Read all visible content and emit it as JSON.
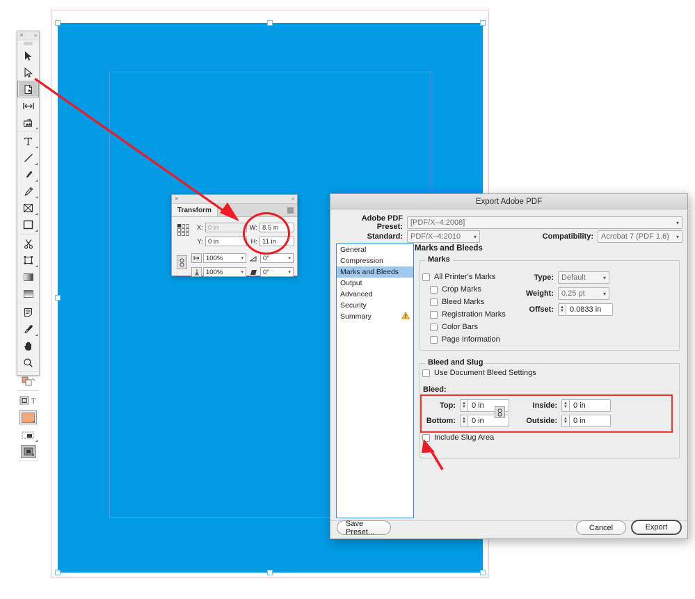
{
  "app": {
    "canvas": {
      "document_fill_color": "#019ae4",
      "page_border_color": "#f6c8cd",
      "margin_guide_color": "#8f7bd6",
      "selection_handle_color": "#6fc5ef"
    }
  },
  "toolbar": {
    "close_glyph": "✕",
    "expand_glyph": "»",
    "tools": [
      {
        "name": "selection-tool",
        "label": "Selection Tool",
        "selected": false,
        "submenu": false
      },
      {
        "name": "direct-selection-tool",
        "label": "Direct Selection Tool",
        "selected": false,
        "submenu": false
      },
      {
        "name": "page-tool",
        "label": "Page Tool",
        "selected": true,
        "submenu": false
      },
      {
        "name": "gap-tool",
        "label": "Gap Tool",
        "selected": false,
        "submenu": false
      },
      {
        "name": "content-collector-tool",
        "label": "Content Collector Tool",
        "selected": false,
        "submenu": true
      },
      {
        "name": "type-tool",
        "label": "Type Tool",
        "selected": false,
        "submenu": true
      },
      {
        "name": "line-tool",
        "label": "Line Tool",
        "selected": false,
        "submenu": true
      },
      {
        "name": "pen-tool",
        "label": "Pen Tool",
        "selected": false,
        "submenu": true
      },
      {
        "name": "pencil-tool",
        "label": "Pencil Tool",
        "selected": false,
        "submenu": true
      },
      {
        "name": "frame-tool",
        "label": "Rectangle Frame Tool",
        "selected": false,
        "submenu": true
      },
      {
        "name": "rectangle-tool",
        "label": "Rectangle Tool",
        "selected": false,
        "submenu": true
      },
      {
        "name": "scissors-tool",
        "label": "Scissors Tool",
        "selected": false,
        "submenu": false
      },
      {
        "name": "free-transform-tool",
        "label": "Free Transform Tool",
        "selected": false,
        "submenu": true
      },
      {
        "name": "gradient-swatch-tool",
        "label": "Gradient Swatch Tool",
        "selected": false,
        "submenu": false
      },
      {
        "name": "gradient-feather-tool",
        "label": "Gradient Feather Tool",
        "selected": false,
        "submenu": false
      },
      {
        "name": "note-tool",
        "label": "Note Tool",
        "selected": false,
        "submenu": false
      },
      {
        "name": "eyedropper-tool",
        "label": "Eyedropper Tool",
        "selected": false,
        "submenu": true
      },
      {
        "name": "hand-tool",
        "label": "Hand Tool",
        "selected": false,
        "submenu": false
      },
      {
        "name": "zoom-tool",
        "label": "Zoom Tool",
        "selected": false,
        "submenu": false
      }
    ],
    "fill_stroke": {
      "fill_color": "#f8a676",
      "label": "Fill and Stroke"
    },
    "formatting_affects": {
      "container_label": "Formatting affects container",
      "text_label": "T"
    },
    "screen_mode": {
      "label": "Screen Mode"
    },
    "apply_mode": {
      "label": "Apply None"
    }
  },
  "transform_panel": {
    "title": "Transform",
    "close_glyph": "✕",
    "collapse_glyph": "«",
    "fields": {
      "x_label": "X:",
      "x_value": "0 in",
      "y_label": "Y:",
      "y_value": "0 in",
      "w_label": "W:",
      "w_value": "8.5 in",
      "h_label": "H:",
      "h_value": "11 in",
      "scale_x_value": "100%",
      "scale_y_value": "100%",
      "rotation_value": "0°",
      "shear_value": "0°"
    },
    "highlight_color": "#ee1b24"
  },
  "export_dialog": {
    "title": "Export Adobe PDF",
    "preset": {
      "label": "Adobe PDF Preset:",
      "value": "[PDF/X–4:2008]"
    },
    "standard": {
      "label": "Standard:",
      "value": "PDF/X–4:2010"
    },
    "compatibility": {
      "label": "Compatibility:",
      "value": "Acrobat 7 (PDF 1.6)"
    },
    "nav_items": [
      {
        "label": "General",
        "active": false,
        "warning": false
      },
      {
        "label": "Compression",
        "active": false,
        "warning": false
      },
      {
        "label": "Marks and Bleeds",
        "active": true,
        "warning": false
      },
      {
        "label": "Output",
        "active": false,
        "warning": false
      },
      {
        "label": "Advanced",
        "active": false,
        "warning": false
      },
      {
        "label": "Security",
        "active": false,
        "warning": false
      },
      {
        "label": "Summary",
        "active": false,
        "warning": true
      }
    ],
    "panel_title": "Marks and Bleeds",
    "marks": {
      "legend": "Marks",
      "checkboxes": [
        {
          "label": "All Printer's Marks",
          "checked": false,
          "indent": 0
        },
        {
          "label": "Crop Marks",
          "checked": false,
          "indent": 1
        },
        {
          "label": "Bleed Marks",
          "checked": false,
          "indent": 1
        },
        {
          "label": "Registration Marks",
          "checked": false,
          "indent": 1
        },
        {
          "label": "Color Bars",
          "checked": false,
          "indent": 1
        },
        {
          "label": "Page Information",
          "checked": false,
          "indent": 1
        }
      ],
      "type": {
        "label": "Type:",
        "value": "Default"
      },
      "weight": {
        "label": "Weight:",
        "value": "0.25 pt"
      },
      "offset": {
        "label": "Offset:",
        "value": "0.0833 in"
      }
    },
    "bleed_and_slug": {
      "legend": "Bleed and Slug",
      "use_document_bleed": {
        "label": "Use Document Bleed Settings",
        "checked": false
      },
      "bleed_label": "Bleed:",
      "fields": [
        {
          "label": "Top:",
          "value": "0 in"
        },
        {
          "label": "Inside:",
          "value": "0 in"
        },
        {
          "label": "Bottom:",
          "value": "0 in"
        },
        {
          "label": "Outside:",
          "value": "0 in"
        }
      ],
      "link_glyph": "⚭",
      "include_slug": {
        "label": "Include Slug Area",
        "checked": false
      },
      "highlight_color": "#f2332d"
    },
    "buttons": {
      "save_preset": "Save Preset...",
      "cancel": "Cancel",
      "export": "Export"
    }
  },
  "annotations": {
    "arrow_color": "#ee1b24",
    "arrow_1_label": "arrow-pointing-to-transform-width",
    "arrow_2_label": "arrow-pointing-to-include-slug-checkbox"
  }
}
